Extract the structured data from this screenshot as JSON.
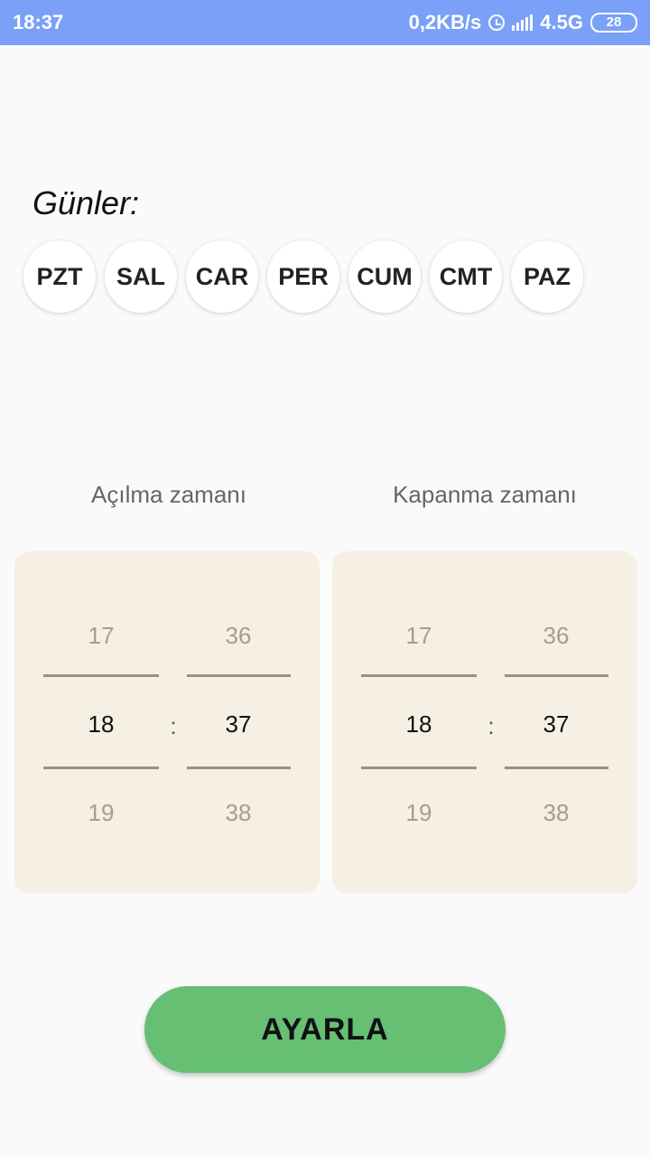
{
  "status_bar": {
    "time": "18:37",
    "speed": "0,2KB/s",
    "network": "4.5G",
    "battery": "28"
  },
  "days_label": "Günler:",
  "days": [
    "PZT",
    "SAL",
    "CAR",
    "PER",
    "CUM",
    "CMT",
    "PAZ"
  ],
  "open_picker": {
    "title": "Açılma zamanı",
    "hour": {
      "prev": "17",
      "current": "18",
      "next": "19"
    },
    "minute": {
      "prev": "36",
      "current": "37",
      "next": "38"
    },
    "separator": ":"
  },
  "close_picker": {
    "title": "Kapanma zamanı",
    "hour": {
      "prev": "17",
      "current": "18",
      "next": "19"
    },
    "minute": {
      "prev": "36",
      "current": "37",
      "next": "38"
    },
    "separator": ":"
  },
  "action_button": "AYARLA",
  "colors": {
    "status_bar": "#7aa0f8",
    "picker_bg": "#f6efe3",
    "button": "#66bf73"
  }
}
